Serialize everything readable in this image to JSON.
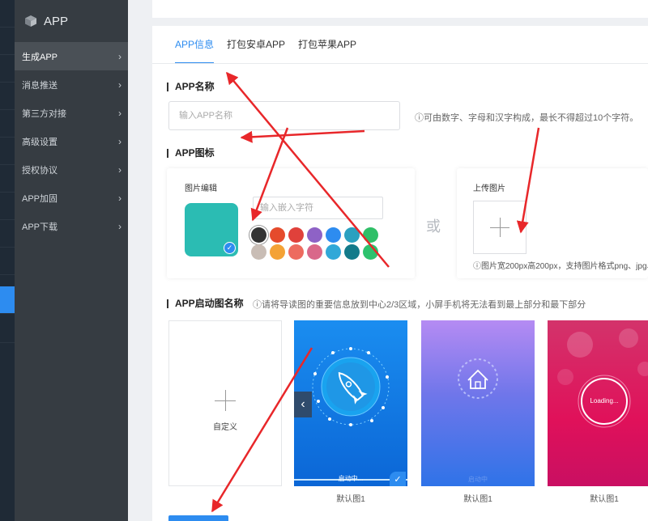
{
  "sidebar": {
    "title": "APP",
    "items": [
      {
        "label": "生成APP"
      },
      {
        "label": "消息推送"
      },
      {
        "label": "第三方对接"
      },
      {
        "label": "高级设置"
      },
      {
        "label": "授权协议"
      },
      {
        "label": "APP加固"
      },
      {
        "label": "APP下载"
      }
    ]
  },
  "tabs": [
    {
      "label": "APP信息"
    },
    {
      "label": "打包安卓APP"
    },
    {
      "label": "打包苹果APP"
    }
  ],
  "app_name": {
    "title": "APP名称",
    "placeholder": "输入APP名称",
    "hint": "ⓘ可由数字、字母和汉字构成，最长不得超过10个字符。"
  },
  "app_icon": {
    "title": "APP图标",
    "edit_label": "图片编辑",
    "embed_placeholder": "输入嵌入字符",
    "or": "或",
    "upload_label": "上传图片",
    "upload_hint": "ⓘ图片宽200px高200px，支持图片格式png、jpg、",
    "preview_color": "#2bbcb3",
    "swatches": [
      "#333333",
      "#e54b2c",
      "#e0413b",
      "#8e62c6",
      "#2d8cf0",
      "#2aa0c0",
      "#2fbf67",
      "#c9bdb5",
      "#f4a235",
      "#ed6b5f",
      "#d9688a",
      "#31a8d8",
      "#137a8a",
      "#2dc26d"
    ]
  },
  "splash": {
    "title": "APP启动图名称",
    "hint": "ⓘ请将导读图的重要信息放到中心2/3区域，小屏手机将无法看到最上部分和最下部分",
    "custom_label": "自定义",
    "items": [
      {
        "label": "默认图1",
        "caption": "启动中..."
      },
      {
        "label": "默认图1",
        "caption": "启动中"
      },
      {
        "label": "默认图1",
        "caption": "Loading..."
      }
    ]
  },
  "icons": {
    "nav_prev": "‹",
    "check": "✓"
  }
}
